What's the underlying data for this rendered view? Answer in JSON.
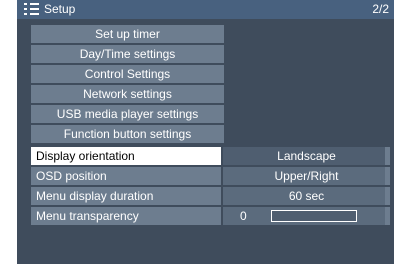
{
  "header": {
    "title": "Setup",
    "page_indicator": "2/2"
  },
  "submenus": [
    "Set up timer",
    "Day/Time settings",
    "Control Settings",
    "Network settings",
    "USB media player settings",
    "Function button settings"
  ],
  "settings": {
    "display_orientation": {
      "label": "Display orientation",
      "value": "Landscape"
    },
    "osd_position": {
      "label": "OSD position",
      "value": "Upper/Right"
    },
    "menu_display_duration": {
      "label": "Menu display duration",
      "value": "60 sec"
    },
    "menu_transparency": {
      "label": "Menu transparency",
      "value": "0",
      "level": 0
    }
  }
}
